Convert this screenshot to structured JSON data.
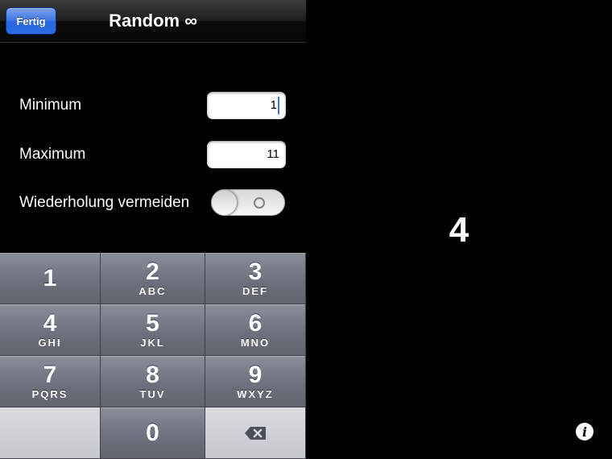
{
  "navbar": {
    "done_label": "Fertig",
    "title": "Random ∞"
  },
  "settings": {
    "minimum_label": "Minimum",
    "minimum_value": "1",
    "maximum_label": "Maximum",
    "maximum_value": "11",
    "avoid_repeat_label": "Wiederholung vermeiden",
    "avoid_repeat_on": false
  },
  "keypad": {
    "keys": [
      {
        "digit": "1",
        "letters": ""
      },
      {
        "digit": "2",
        "letters": "ABC"
      },
      {
        "digit": "3",
        "letters": "DEF"
      },
      {
        "digit": "4",
        "letters": "GHI"
      },
      {
        "digit": "5",
        "letters": "JKL"
      },
      {
        "digit": "6",
        "letters": "MNO"
      },
      {
        "digit": "7",
        "letters": "PQRS"
      },
      {
        "digit": "8",
        "letters": "TUV"
      },
      {
        "digit": "9",
        "letters": "WXYZ"
      },
      {
        "digit": "0",
        "letters": ""
      }
    ],
    "delete_icon": "backspace-icon"
  },
  "result": {
    "value": "4"
  },
  "info_button": {
    "icon": "info-icon",
    "glyph": "i"
  },
  "colors": {
    "accent": "#2c6de4",
    "background": "#000000",
    "cursor": "#3b6cf5"
  }
}
